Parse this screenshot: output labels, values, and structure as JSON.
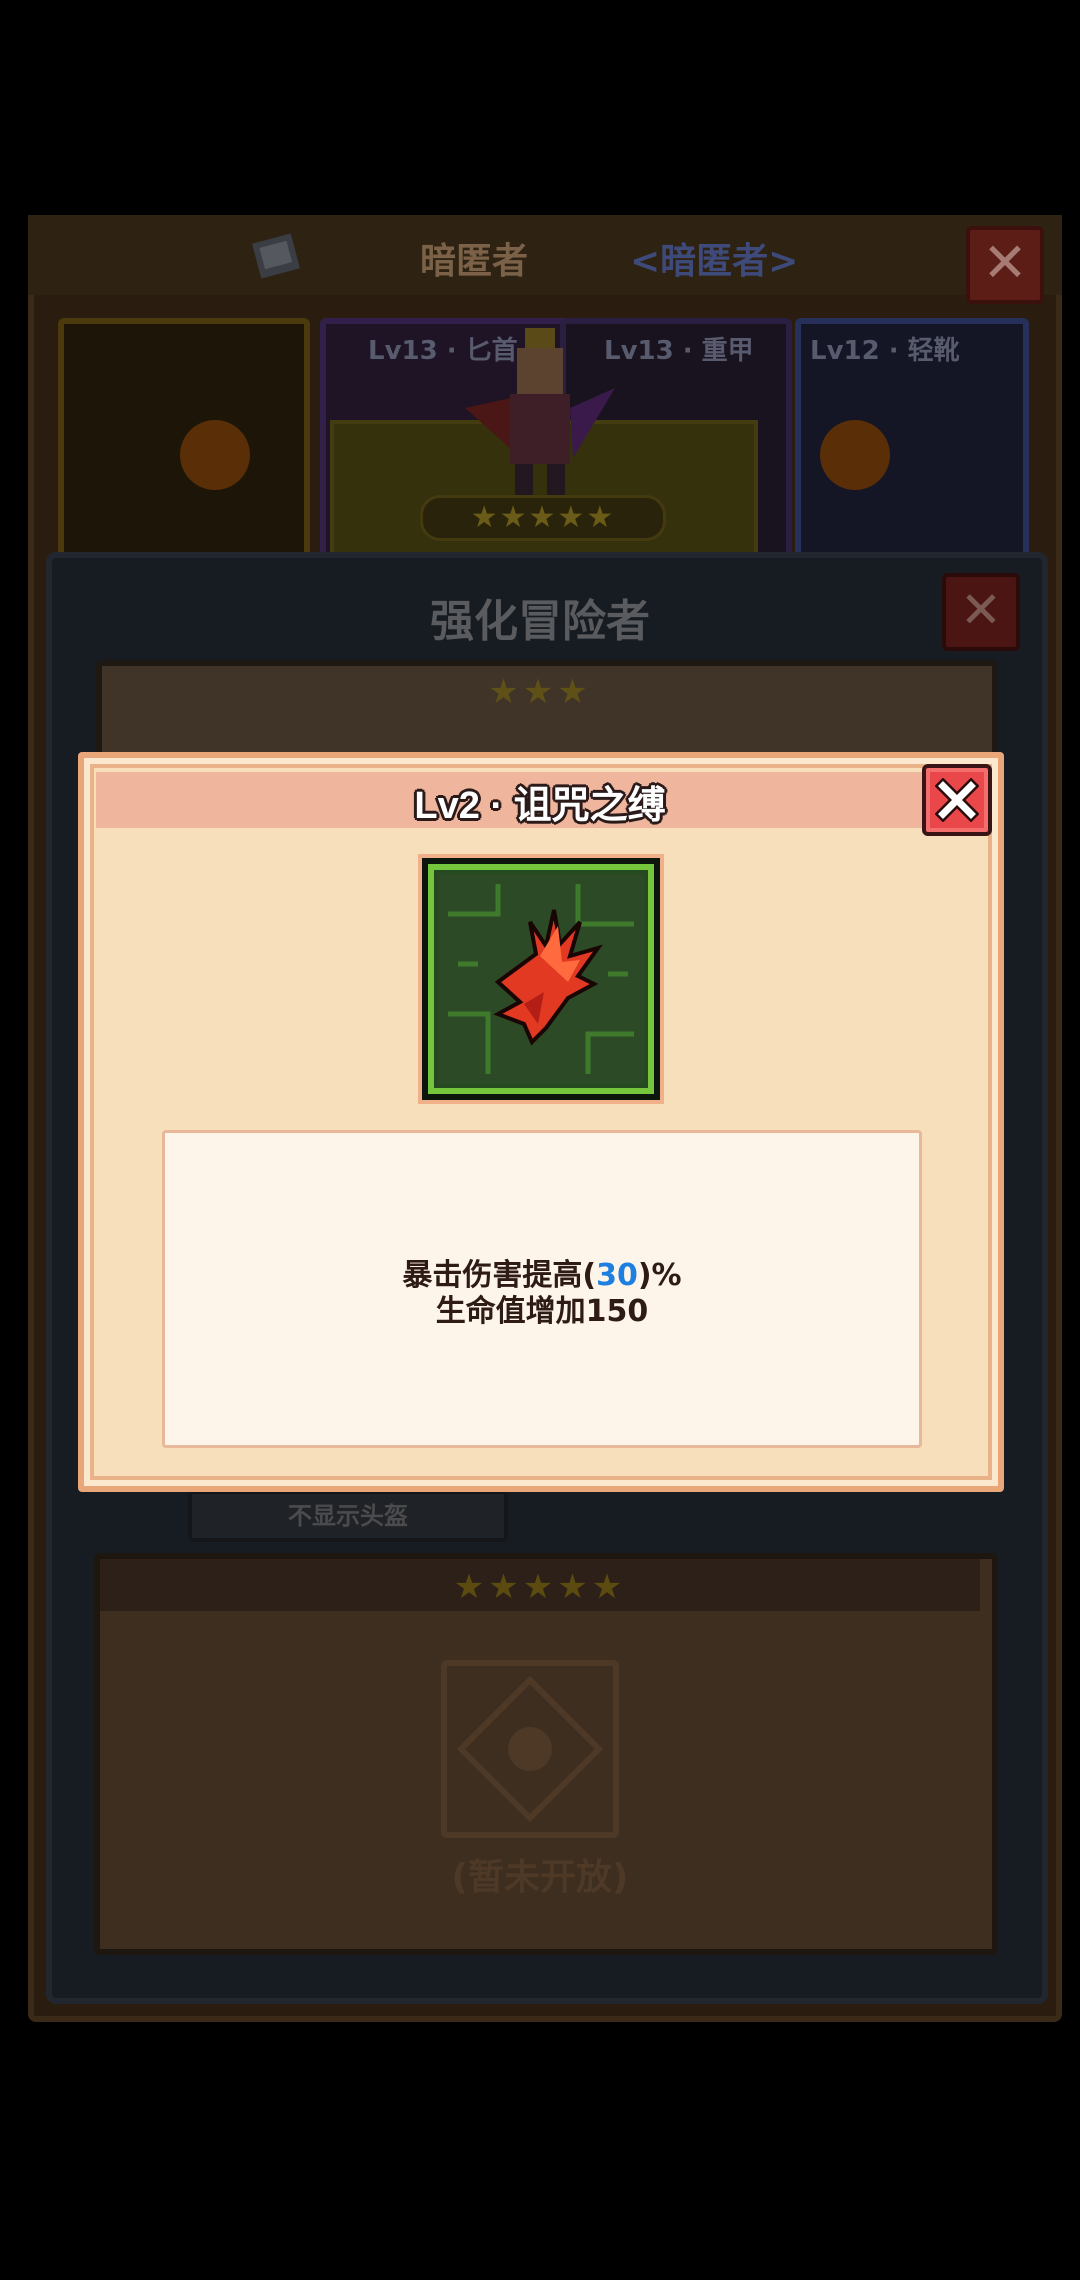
{
  "background": {
    "hero_name": "暗匿者",
    "hero_class_tag": "<暗匿者>",
    "equip_cards": [
      {
        "label": ""
      },
      {
        "label": "Lv13 · 匕首"
      },
      {
        "label": "Lv13 · 重甲"
      },
      {
        "label": "Lv12 · 轻靴"
      }
    ],
    "hero_stars": "★★★★★",
    "upgrade_panel": {
      "title": "强化冒险者",
      "tier_three_stars": "★★★",
      "helmet_toggle_label": "不显示头盔",
      "tier_five_stars": "★★★★★",
      "locked_text": "(暂未开放)"
    }
  },
  "dialog": {
    "title": "Lv2 · 诅咒之缚",
    "skill_icon": "red-claw-icon",
    "description": {
      "line1_prefix": "暴击伤害提高(",
      "line1_value": "30",
      "line1_suffix": ")%",
      "line2": "生命值增加150"
    }
  },
  "colors": {
    "highlight": "#1d7fe0",
    "dialog_bg": "#f6dfba",
    "dialog_header": "#efb59d",
    "close_button": "#e9474a"
  }
}
